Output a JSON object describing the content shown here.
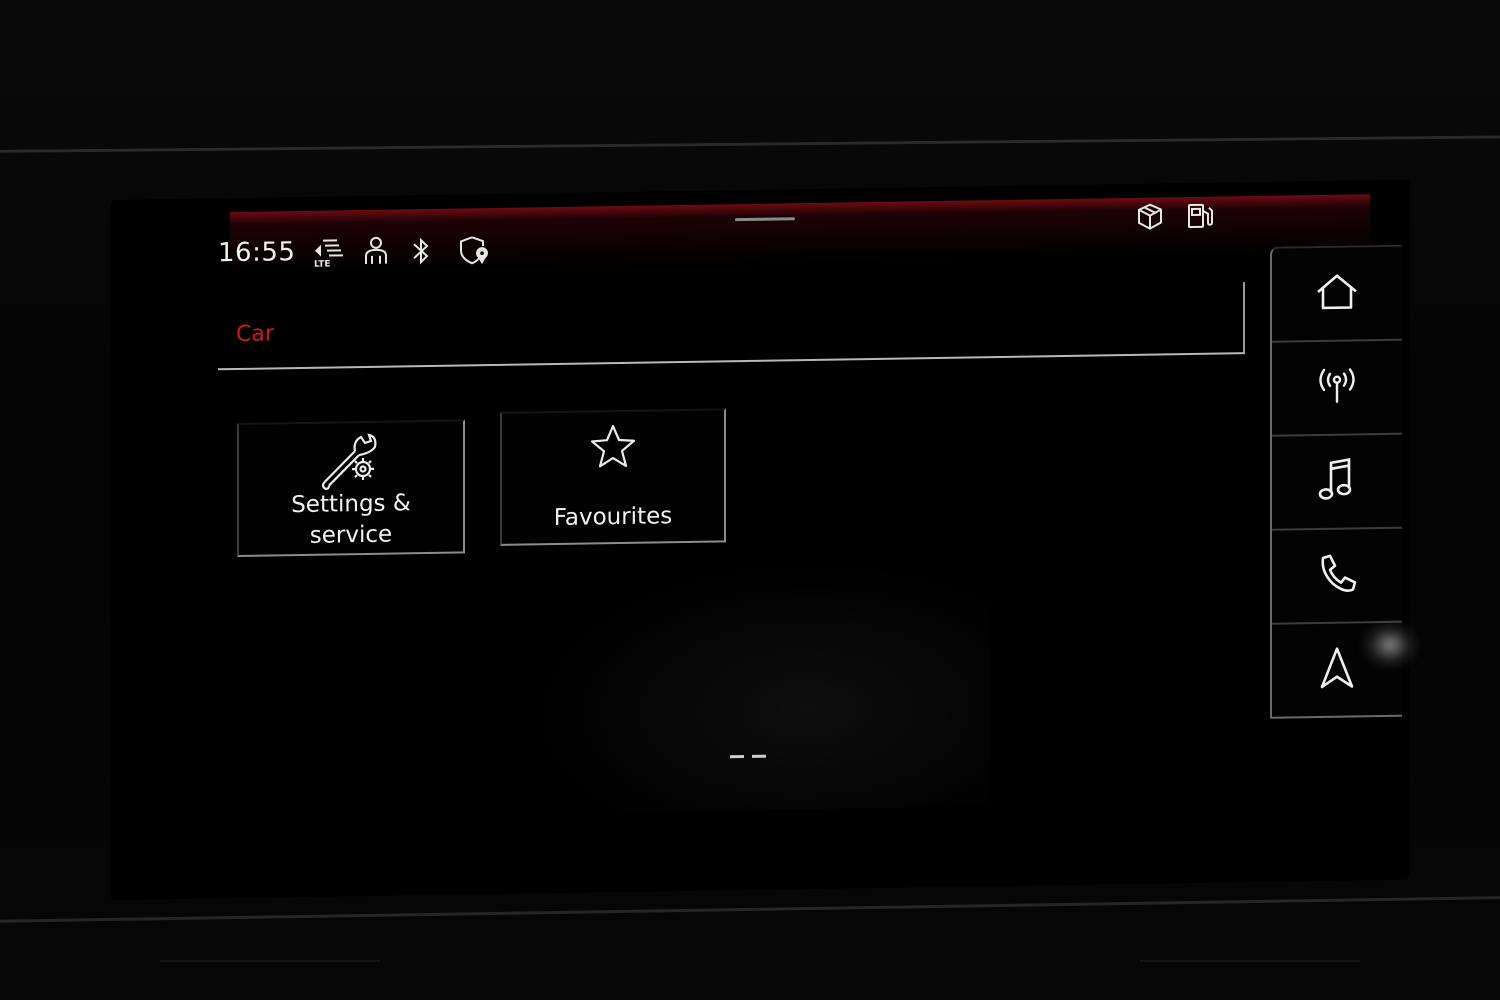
{
  "status_bar": {
    "time": "16:55",
    "icons": [
      "lte-signal-icon",
      "driver-profile-icon",
      "bluetooth-icon",
      "location-shield-icon"
    ],
    "right_icons": [
      "package-icon",
      "fuel-pump-icon"
    ]
  },
  "header": {
    "title": "Car"
  },
  "tiles": [
    {
      "label_line1": "Settings &",
      "label_line2": "service",
      "icon": "wrench-gear-icon"
    },
    {
      "label": "Favourites",
      "icon": "star-icon"
    }
  ],
  "side_nav": {
    "items": [
      "home-icon",
      "radio-antenna-icon",
      "music-note-icon",
      "phone-icon",
      "navigation-arrow-icon"
    ]
  },
  "pagination": {
    "pages": 2
  },
  "colors": {
    "accent": "#d4151f",
    "background": "#000000",
    "foreground": "#f0f0f0"
  }
}
